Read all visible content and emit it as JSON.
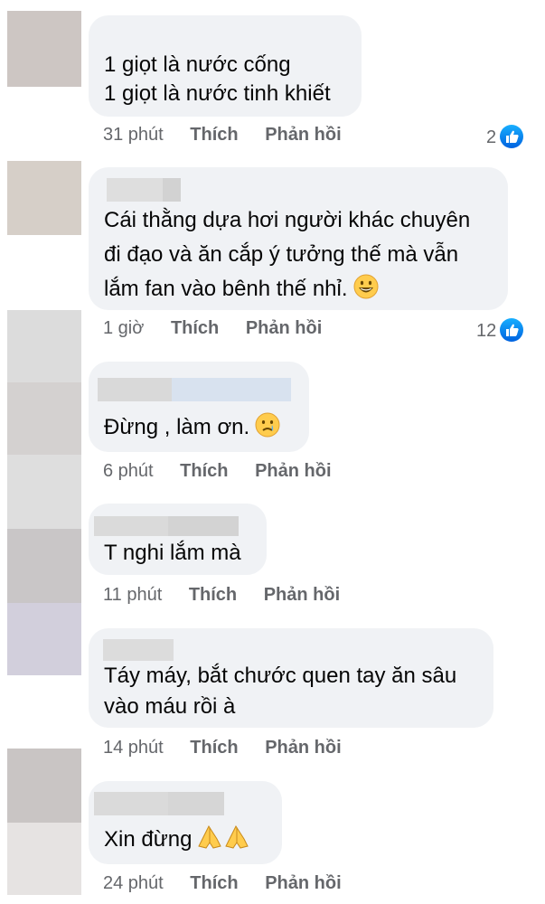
{
  "comments": [
    {
      "lines": [
        "1 giọt là nước cống",
        "1 giọt là nước tinh khiết"
      ],
      "time": "31 phút",
      "like_label": "Thích",
      "reply_label": "Phản hồi",
      "reaction_count": "2",
      "reaction_icon": "like-icon"
    },
    {
      "lines": [
        "Cái thằng dựa hơi người khác chuyên",
        "đi đạo và ăn cắp ý tưởng thế mà vẫn",
        "lắm fan vào bênh thế nhỉ."
      ],
      "emoji": "grinning-face-emoji",
      "time": "1 giờ",
      "like_label": "Thích",
      "reply_label": "Phản hồi",
      "reaction_count": "12",
      "reaction_icon": "like-icon"
    },
    {
      "lines": [
        "Đừng , làm ơn."
      ],
      "emoji": "crying-face-emoji",
      "time": "6 phút",
      "like_label": "Thích",
      "reply_label": "Phản hồi"
    },
    {
      "lines": [
        "T nghi lắm mà"
      ],
      "time": "11 phút",
      "like_label": "Thích",
      "reply_label": "Phản hồi"
    },
    {
      "lines": [
        "Táy máy, bắt chước quen tay ăn sâu",
        "vào máu rồi à"
      ],
      "time": "14 phút",
      "like_label": "Thích",
      "reply_label": "Phản hồi"
    },
    {
      "lines": [
        "Xin đừng"
      ],
      "emoji": "folded-hands-emoji",
      "time": "24 phút",
      "like_label": "Thích",
      "reply_label": "Phản hồi"
    }
  ],
  "colors": {
    "bubble": "#f0f2f5",
    "meta_text": "#65676b",
    "body_text": "#050505",
    "like_blue": "#1877f2"
  }
}
